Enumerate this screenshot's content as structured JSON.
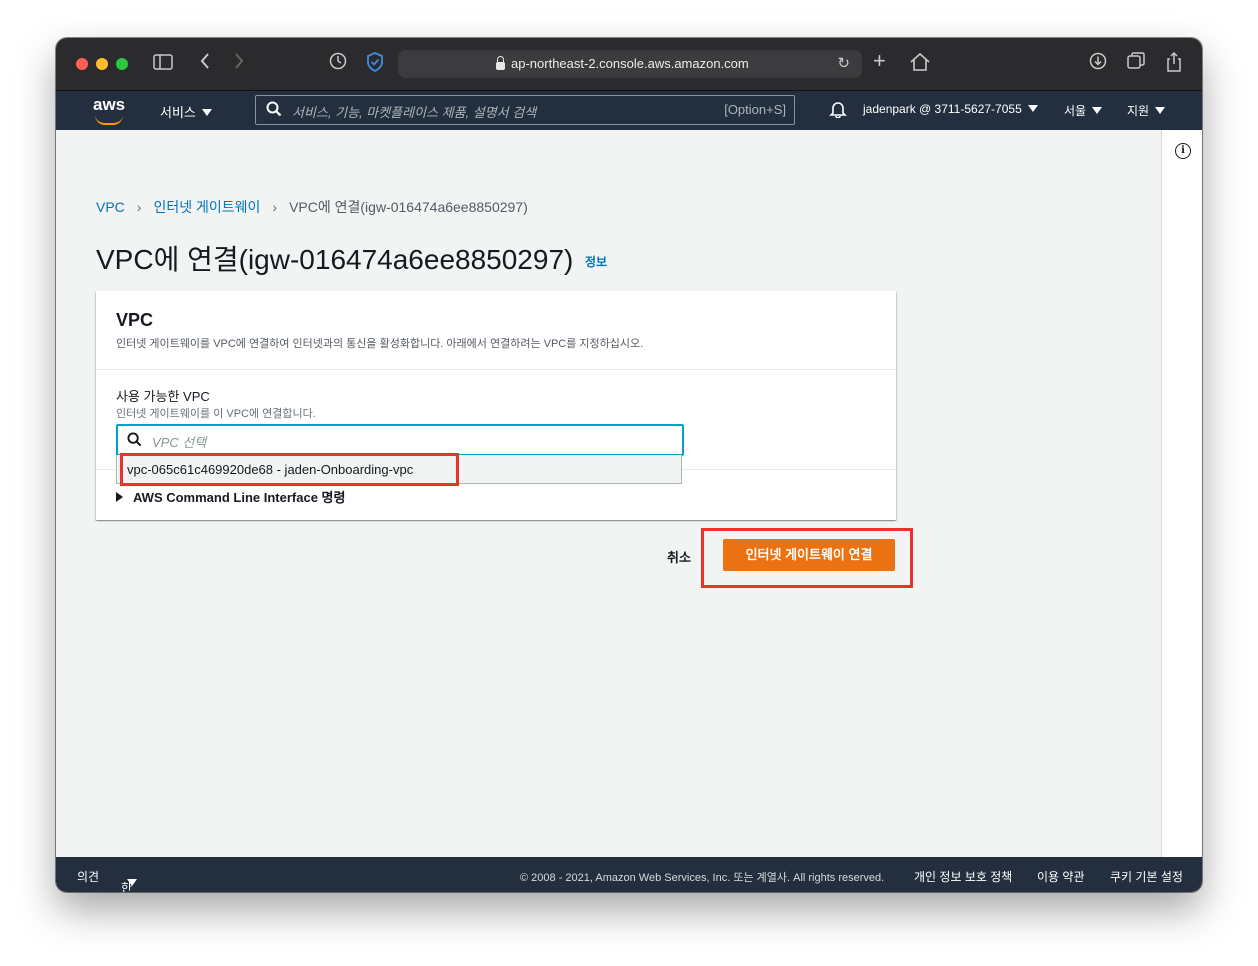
{
  "browser": {
    "url": "ap-northeast-2.console.aws.amazon.com"
  },
  "nav": {
    "logo_text": "aws",
    "services_label": "서비스",
    "search_placeholder": "서비스, 기능, 마켓플레이스 제품, 설명서 검색",
    "search_shortcut": "[Option+S]",
    "account": "jadenpark @ 3711-5627-7055",
    "region": "서울",
    "support": "지원"
  },
  "breadcrumb": {
    "items": [
      "VPC",
      "인터넷 게이트웨이",
      "VPC에 연결(igw-016474a6ee8850297)"
    ]
  },
  "page": {
    "title": "VPC에 연결(igw-016474a6ee8850297)",
    "info_link": "정보"
  },
  "panel": {
    "title": "VPC",
    "description": "인터넷 게이트웨이를 VPC에 연결하여 인터넷과의 통신을 활성화합니다. 아래에서 연결하려는 VPC를 지정하십시오.",
    "field_label": "사용 가능한 VPC",
    "field_description": "인터넷 게이트웨이를 이 VPC에 연결합니다.",
    "select_placeholder": "VPC 선택",
    "dropdown_option": "vpc-065c61c469920de68 - jaden-Onboarding-vpc",
    "cli_expander": "AWS Command Line Interface 명령"
  },
  "actions": {
    "cancel": "취소",
    "primary": "인터넷 게이트웨이 연결"
  },
  "footer": {
    "feedback": "의견",
    "language": "한국어",
    "copyright": "© 2008 - 2021, Amazon Web Services, Inc. 또는 계열사. All rights reserved.",
    "privacy": "개인 정보 보호 정책",
    "terms": "이용 약관",
    "cookies": "쿠키 기본 설정"
  },
  "colors": {
    "aws_nav": "#232f3e",
    "primary_button": "#ec7211",
    "link": "#0073bb",
    "highlight": "#e8332a",
    "focus": "#00a1c9"
  }
}
